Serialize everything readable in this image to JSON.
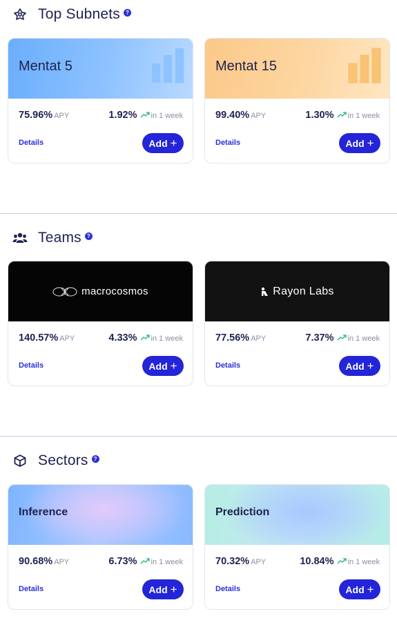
{
  "sections": [
    {
      "title": "Top Subnets",
      "icon": "network-icon",
      "cards": [
        {
          "name": "Mentat 5",
          "apy": "75.96%",
          "apy_label": "APY",
          "change": "1.92%",
          "change_label": "in 1 week",
          "details": "Details",
          "add": "Add",
          "style": "blue-gradient",
          "bar_color": "#8ec3ff"
        },
        {
          "name": "Mentat 15",
          "apy": "99.40%",
          "apy_label": "APY",
          "change": "1.30%",
          "change_label": "in 1 week",
          "details": "Details",
          "add": "Add",
          "style": "orange-gradient",
          "bar_color": "#f9c274"
        }
      ]
    },
    {
      "title": "Teams",
      "icon": "users-icon",
      "cards": [
        {
          "name": "macrocosmos",
          "apy": "140.57%",
          "apy_label": "APY",
          "change": "4.33%",
          "change_label": "in 1 week",
          "details": "Details",
          "add": "Add",
          "style": "black"
        },
        {
          "name": "Rayon Labs",
          "apy": "77.56%",
          "apy_label": "APY",
          "change": "7.37%",
          "change_label": "in 1 week",
          "details": "Details",
          "add": "Add",
          "style": "black"
        }
      ]
    },
    {
      "title": "Sectors",
      "icon": "cube-icon",
      "cards": [
        {
          "name": "Inference",
          "apy": "90.68%",
          "apy_label": "APY",
          "change": "6.73%",
          "change_label": "in 1 week",
          "details": "Details",
          "add": "Add",
          "style": "inference-gradient"
        },
        {
          "name": "Prediction",
          "apy": "70.32%",
          "apy_label": "APY",
          "change": "10.84%",
          "change_label": "in 1 week",
          "details": "Details",
          "add": "Add",
          "style": "prediction-gradient"
        }
      ]
    }
  ],
  "colors": {
    "accent": "#2424d8",
    "text": "#1f2251",
    "muted": "#8b8fa3",
    "trend_up": "#22b573",
    "divider": "#c9cde6"
  }
}
